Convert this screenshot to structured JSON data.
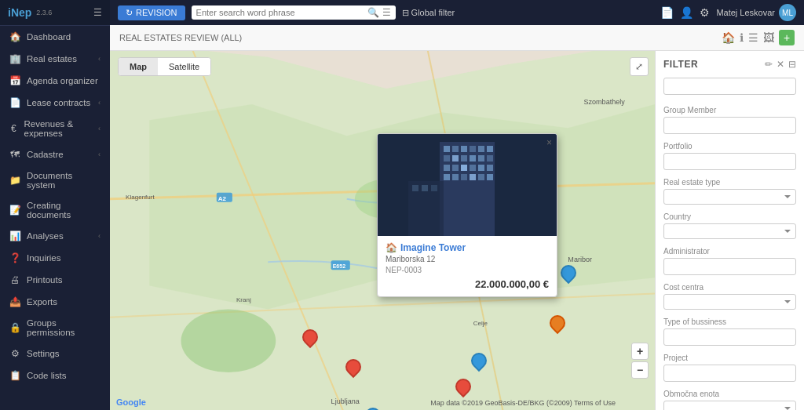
{
  "app": {
    "name": "iNep",
    "version": "2.3.6"
  },
  "topbar": {
    "revision_label": "REVISION",
    "search_placeholder": "Enter search word phrase",
    "global_filter_label": "Global filter",
    "user_name": "Matej Leskovar"
  },
  "sidebar": {
    "items": [
      {
        "id": "dashboard",
        "label": "Dashboard",
        "icon": "🏠"
      },
      {
        "id": "real-estates",
        "label": "Real estates",
        "icon": "🏢",
        "has_arrow": true
      },
      {
        "id": "agenda",
        "label": "Agenda organizer",
        "icon": "📅"
      },
      {
        "id": "lease",
        "label": "Lease contracts",
        "icon": "📄",
        "has_arrow": true
      },
      {
        "id": "revenues",
        "label": "Revenues & expenses",
        "icon": "€",
        "has_arrow": true
      },
      {
        "id": "cadastre",
        "label": "Cadastre",
        "icon": "🗺",
        "has_arrow": true
      },
      {
        "id": "documents",
        "label": "Documents system",
        "icon": "📁"
      },
      {
        "id": "creating",
        "label": "Creating documents",
        "icon": "📝"
      },
      {
        "id": "analyses",
        "label": "Analyses",
        "icon": "📊",
        "has_arrow": true
      },
      {
        "id": "inquiries",
        "label": "Inquiries",
        "icon": "❓"
      },
      {
        "id": "printouts",
        "label": "Printouts",
        "icon": "🖨"
      },
      {
        "id": "exports",
        "label": "Exports",
        "icon": "📤"
      },
      {
        "id": "groups",
        "label": "Groups permissions",
        "icon": "🔒"
      },
      {
        "id": "settings",
        "label": "Settings",
        "icon": "⚙"
      },
      {
        "id": "code-lists",
        "label": "Code lists",
        "icon": "📋"
      }
    ]
  },
  "review": {
    "title": "REAL ESTATES REVIEW (all)"
  },
  "map": {
    "tabs": [
      {
        "label": "Map",
        "active": true
      },
      {
        "label": "Satellite",
        "active": false
      }
    ],
    "popup": {
      "title": "Imagine Tower",
      "address": "Mariborska 12",
      "code": "NEP-0003",
      "price": "22.000.000,00 €",
      "close_label": "×"
    },
    "attribution": "Map data ©2019 GeoBasis-DE/BKG (©2009) Terms of Use",
    "google_label": "Google"
  },
  "filter": {
    "title": "FILTER",
    "sections": [
      {
        "id": "search",
        "placeholder": ""
      },
      {
        "id": "group_member",
        "label": "Group Member"
      },
      {
        "id": "portfolio",
        "label": "Portfolio"
      },
      {
        "id": "real_estate_type",
        "label": "Real estate type"
      },
      {
        "id": "country",
        "label": "Country"
      },
      {
        "id": "administrator",
        "label": "Administrator"
      },
      {
        "id": "cost_centra",
        "label": "Cost centra"
      },
      {
        "id": "type_of_bussiness",
        "label": "Type of bussiness"
      },
      {
        "id": "project",
        "label": "Project"
      },
      {
        "id": "obmocna_enota",
        "label": "Območna enota"
      }
    ],
    "edit_icon": "✏",
    "clear_icon": "✕",
    "funnel_icon": "⊟"
  }
}
